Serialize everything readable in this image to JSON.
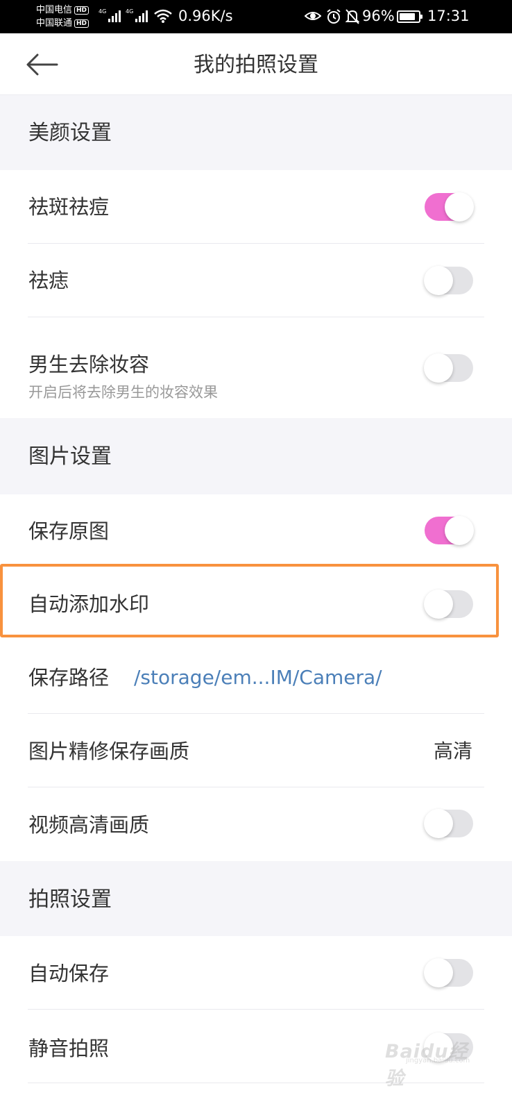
{
  "status_bar": {
    "carrier1": "中国电信",
    "carrier2": "中国联通",
    "hd": "HD",
    "net_type": "4G",
    "net_speed": "0.96K/s",
    "battery_percent": "96%",
    "time": "17:31"
  },
  "header": {
    "title": "我的拍照设置"
  },
  "sections": {
    "beauty": {
      "title": "美颜设置"
    },
    "picture": {
      "title": "图片设置"
    },
    "photo": {
      "title": "拍照设置"
    }
  },
  "rows": {
    "spot_removal": {
      "label": "祛斑祛痘",
      "toggle_on": true
    },
    "mole_removal": {
      "label": "祛痣",
      "toggle_on": false
    },
    "male_makeup": {
      "label": "男生去除妆容",
      "sub": "开启后将去除男生的妆容效果",
      "toggle_on": false
    },
    "save_original": {
      "label": "保存原图",
      "toggle_on": true
    },
    "watermark": {
      "label": "自动添加水印",
      "toggle_on": false
    },
    "save_path": {
      "label": "保存路径",
      "value": "/storage/em...IM/Camera/"
    },
    "retouch_quality": {
      "label": "图片精修保存画质",
      "value": "高清"
    },
    "hd_video": {
      "label": "视频高清画质",
      "toggle_on": false
    },
    "auto_save": {
      "label": "自动保存",
      "toggle_on": false
    },
    "silent_shot": {
      "label": "静音拍照",
      "toggle_on": false
    }
  },
  "watermark_overlay": {
    "text": "Baidu经验",
    "url": "jingyan.baidu.com"
  },
  "colors": {
    "toggle_on": "#f06fd0",
    "toggle_off": "#e3e3e6",
    "section_bg": "#f5f5f9",
    "link": "#4b7fb8",
    "highlight_border": "#f8923e"
  }
}
